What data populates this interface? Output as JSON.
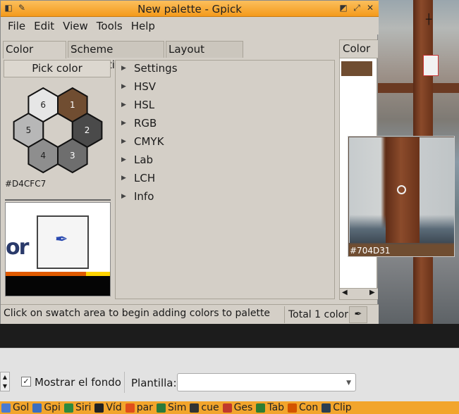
{
  "window": {
    "title": "New palette - Gpick"
  },
  "menu": [
    {
      "label": "File"
    },
    {
      "label": "Edit"
    },
    {
      "label": "View"
    },
    {
      "label": "Tools"
    },
    {
      "label": "Help"
    }
  ],
  "tabs": [
    {
      "label": "Color picker"
    },
    {
      "label": "Scheme generation"
    },
    {
      "label": "Layout preview"
    }
  ],
  "picker": {
    "pick_label": "Pick color",
    "hex_value": "#D4CFC7",
    "swatches": [
      {
        "n": "1",
        "color": "#704d31"
      },
      {
        "n": "2",
        "color": "#4a4a4a"
      },
      {
        "n": "3",
        "color": "#6e6e6e"
      },
      {
        "n": "4",
        "color": "#8e8e8e"
      },
      {
        "n": "5",
        "color": "#b7b7b7"
      },
      {
        "n": "6",
        "color": "#e6e6e6"
      }
    ],
    "center_color": "#d4cfc7"
  },
  "tree": [
    {
      "label": "Settings"
    },
    {
      "label": "HSV"
    },
    {
      "label": "HSL"
    },
    {
      "label": "RGB"
    },
    {
      "label": "CMYK"
    },
    {
      "label": "Lab"
    },
    {
      "label": "LCH"
    },
    {
      "label": "Info"
    }
  ],
  "palette": {
    "column_header": "Color",
    "swatch_color": "#704d31"
  },
  "status": {
    "text": "Click on swatch area to begin adding colors to palette",
    "total": "Total 1 color"
  },
  "magnifier": {
    "code": "#704D31"
  },
  "background_app": {
    "checkbox_label": "Mostrar el fondo",
    "template_label": "Plantilla:",
    "template_value": ""
  },
  "taskbar": [
    {
      "label": "Gol",
      "color": "#4a7ad0"
    },
    {
      "label": "Gpi",
      "color": "#3b6ec0"
    },
    {
      "label": "Siri",
      "color": "#2e8a3e"
    },
    {
      "label": "Víd",
      "color": "#222222"
    },
    {
      "label": "par",
      "color": "#e04e1a"
    },
    {
      "label": "Sim",
      "color": "#2a7a3a"
    },
    {
      "label": "cue",
      "color": "#333333"
    },
    {
      "label": "Ges",
      "color": "#c0392b"
    },
    {
      "label": "Tab",
      "color": "#2e7d32"
    },
    {
      "label": "Con",
      "color": "#d35400"
    },
    {
      "label": "Clip",
      "color": "#2c3e50"
    }
  ]
}
